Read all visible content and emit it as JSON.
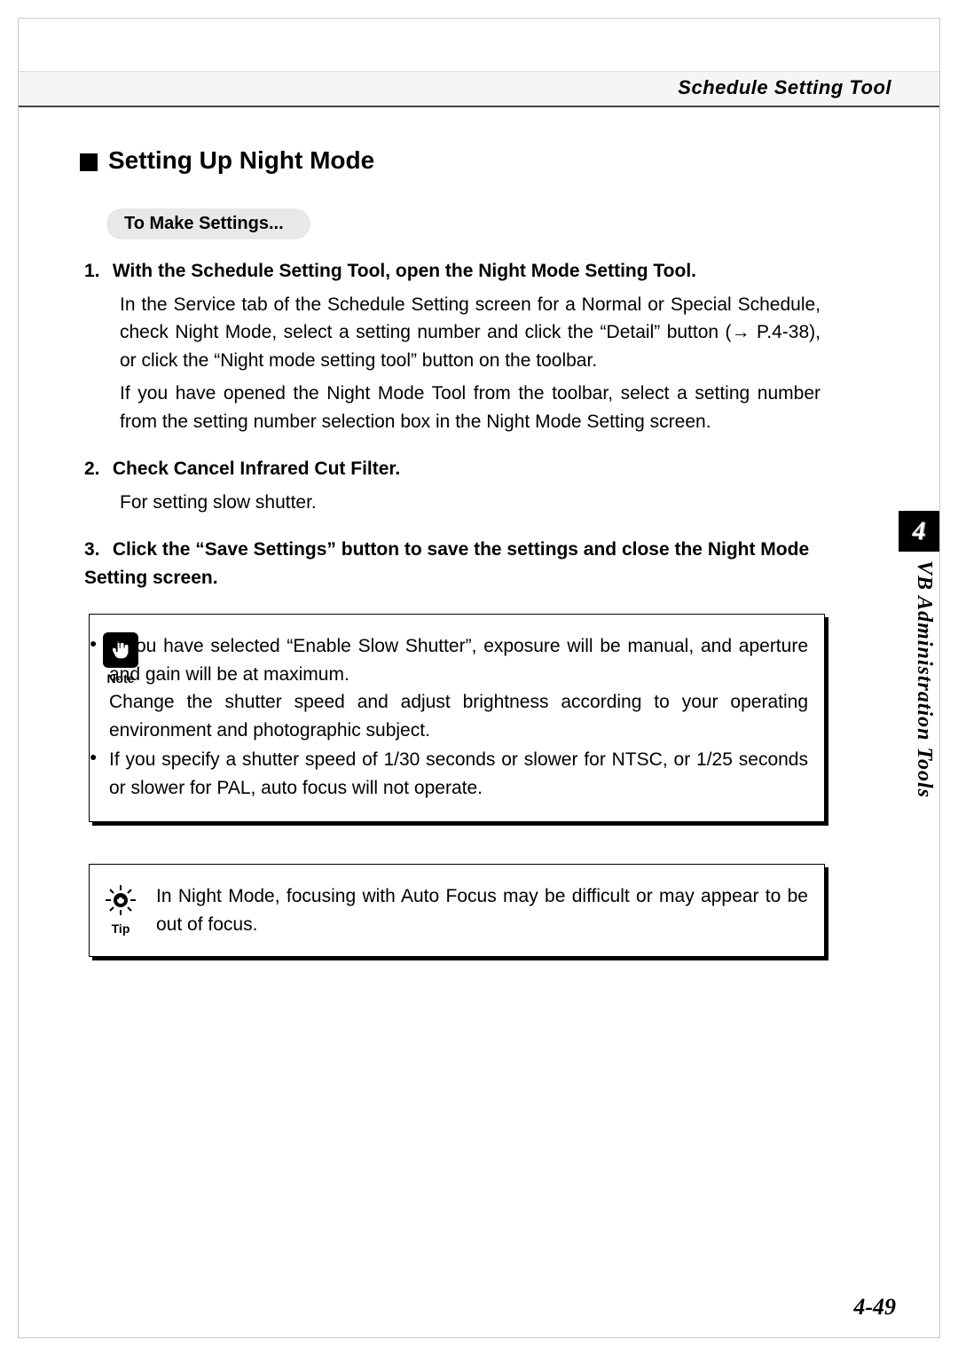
{
  "header": {
    "tool_name": "Schedule Setting Tool"
  },
  "section": {
    "title": "Setting Up Night Mode",
    "pill_label": "To Make Settings..."
  },
  "steps": {
    "s1": {
      "num": "1.",
      "title": "With the Schedule Setting Tool, open the Night Mode Setting Tool.",
      "p1": "In the Service tab of the Schedule Setting screen for a Normal or Special Schedule, check Night Mode, select a setting number and click the “Detail” button (→ P.4-38), or click the “Night mode setting tool” button on the toolbar.",
      "p2": "If you have opened the Night Mode Tool from the toolbar, select a setting number from the setting number selection box in the Night Mode Setting screen."
    },
    "s2": {
      "num": "2.",
      "title": "Check Cancel Infrared Cut Filter.",
      "p1": "For setting slow shutter."
    },
    "s3": {
      "num": "3.",
      "title": "Click the “Save Settings” button to save the settings and close the Night Mode Setting screen."
    }
  },
  "note": {
    "label": "Note",
    "items": [
      "If you have selected “Enable Slow Shutter”, exposure will be manual, and aperture and gain will be at maximum.\nChange the shutter speed and adjust brightness according to your operating environment and photographic subject.",
      "If you specify a shutter speed of 1/30 seconds or slower for NTSC, or 1/25 seconds or slower for PAL, auto focus will not operate."
    ]
  },
  "tip": {
    "label": "Tip",
    "text": "In Night Mode, focusing with Auto Focus may be difficult or may appear to be out of focus."
  },
  "side": {
    "chapter_number": "4",
    "chapter_title": "VB Administration Tools"
  },
  "footer": {
    "page_number": "4-49"
  }
}
